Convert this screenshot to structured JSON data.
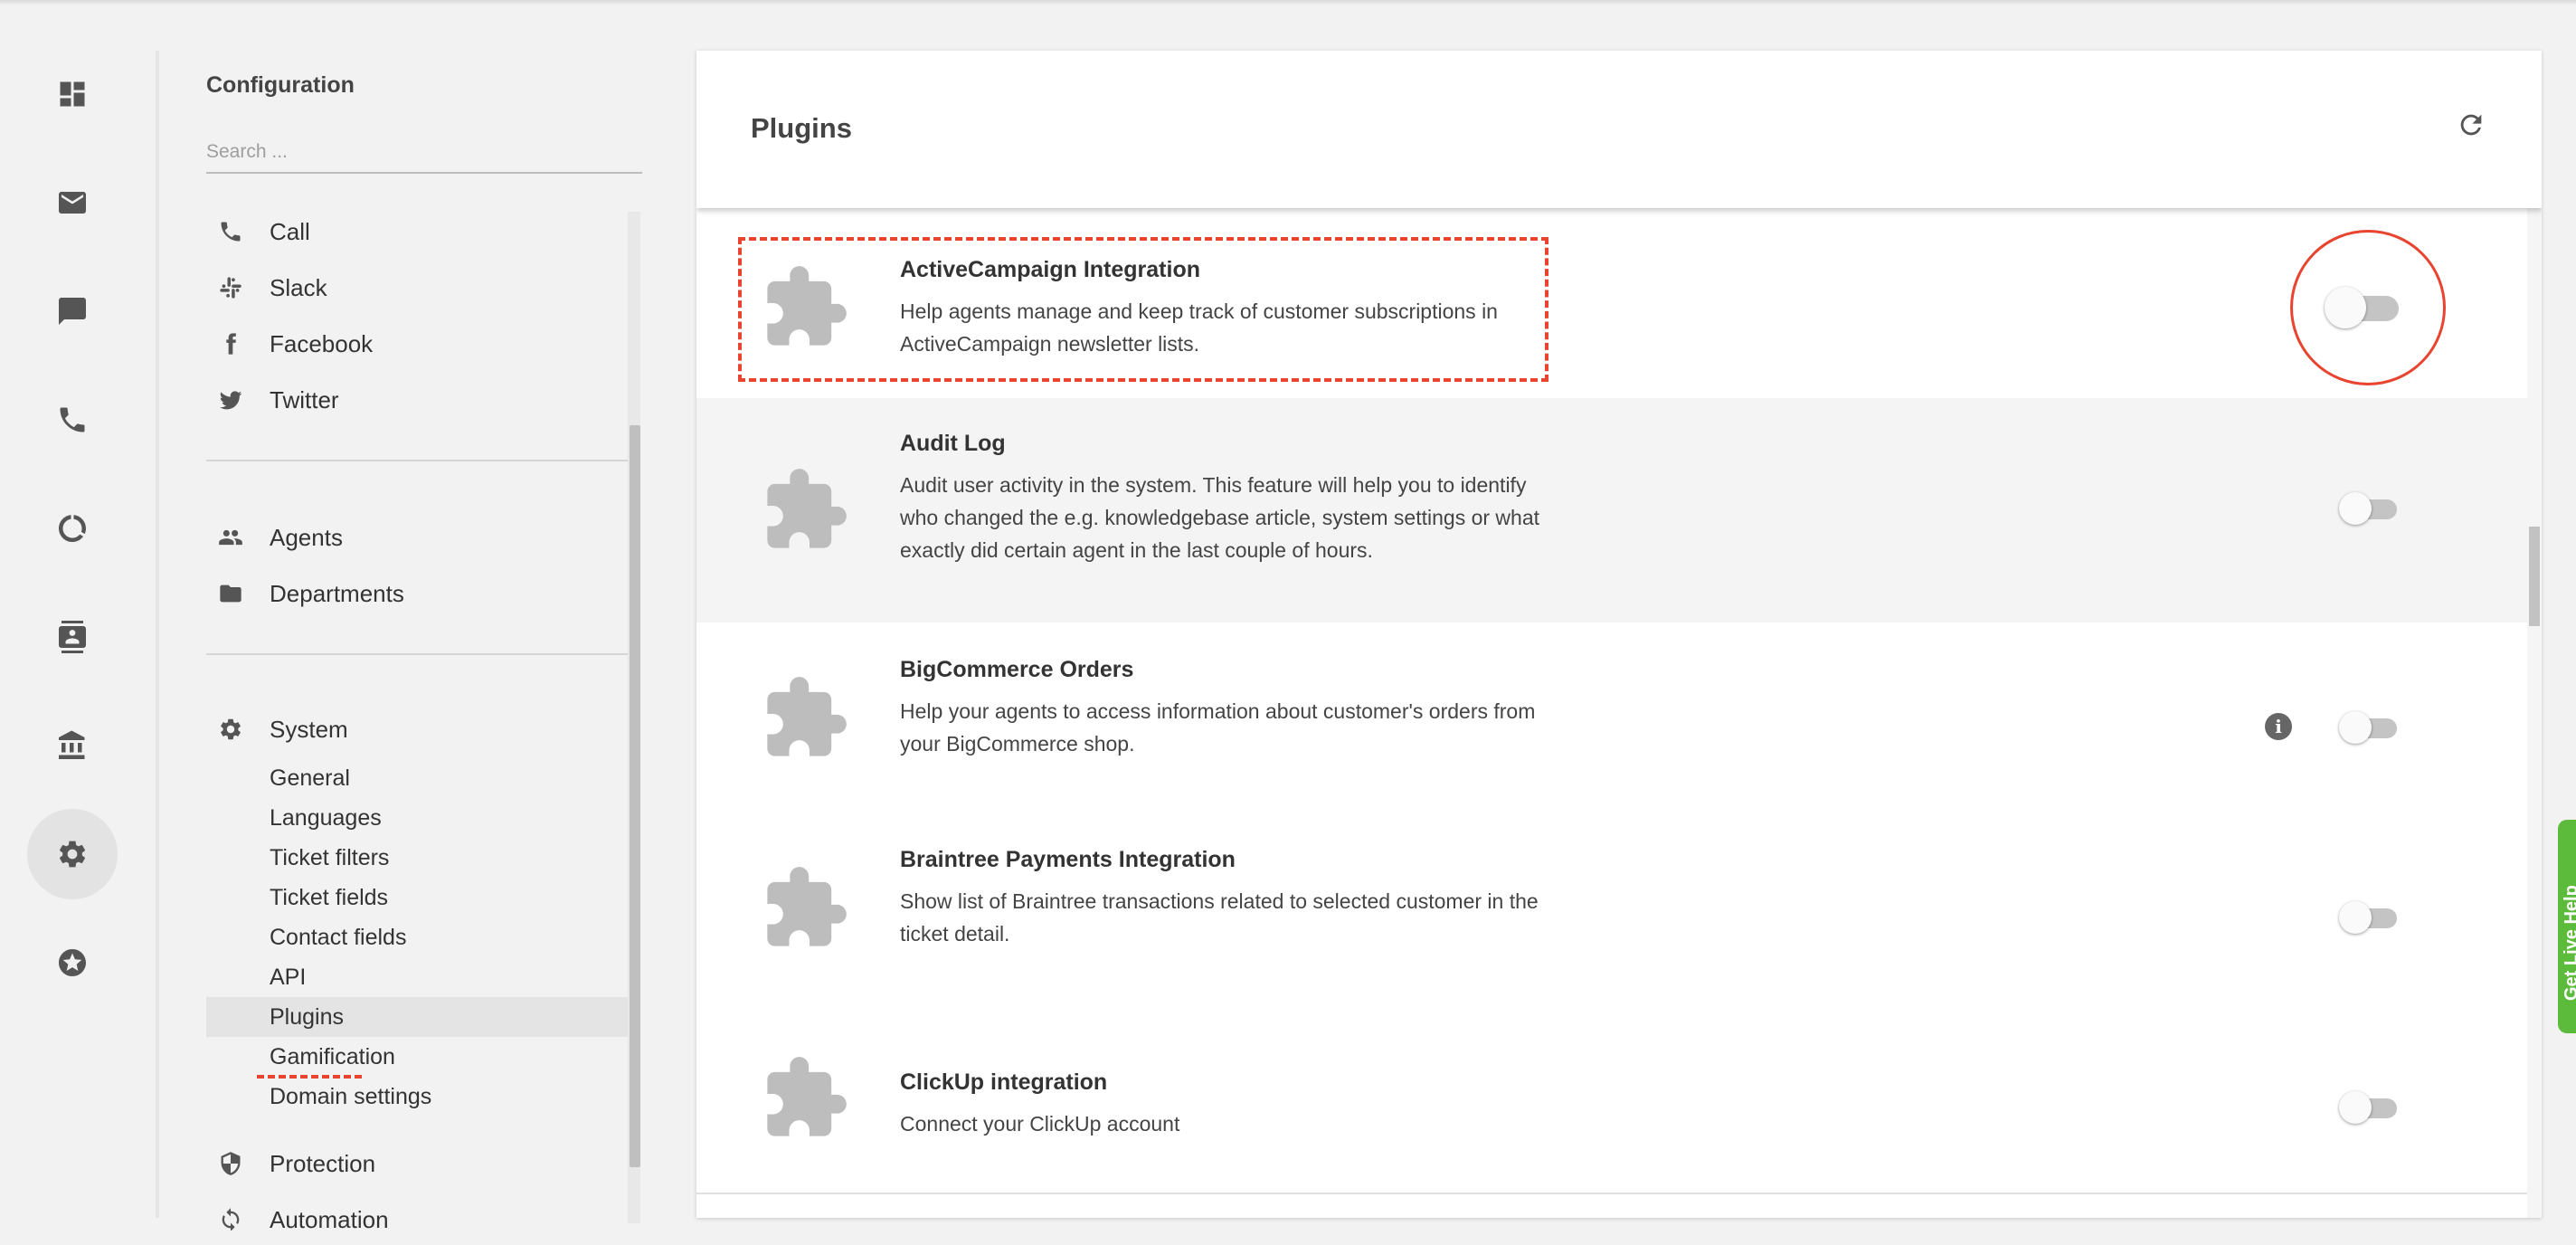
{
  "rail": {
    "items": [
      {
        "name": "dashboard-icon"
      },
      {
        "name": "mail-icon"
      },
      {
        "name": "chat-icon"
      },
      {
        "name": "phone-icon"
      },
      {
        "name": "reports-icon"
      },
      {
        "name": "contacts-icon"
      },
      {
        "name": "knowledgebase-icon"
      },
      {
        "name": "settings-icon",
        "active": true
      },
      {
        "name": "star-icon"
      }
    ]
  },
  "config": {
    "title": "Configuration",
    "search_placeholder": "Search ...",
    "channels": [
      "Call",
      "Slack",
      "Facebook",
      "Twitter"
    ],
    "people": [
      "Agents",
      "Departments"
    ],
    "system": {
      "label": "System",
      "items": [
        "General",
        "Languages",
        "Ticket filters",
        "Ticket fields",
        "Contact fields",
        "API",
        "Plugins",
        "Gamification",
        "Domain settings"
      ],
      "active": "Plugins"
    },
    "protection": "Protection",
    "automation": "Automation"
  },
  "panel": {
    "title": "Plugins",
    "plugins": [
      {
        "name": "ActiveCampaign Integration",
        "desc": "Help agents manage and keep track of customer subscriptions in ActiveCampaign newsletter lists.",
        "enabled": false
      },
      {
        "name": "Audit Log",
        "desc": "Audit user activity in the system. This feature will help you to identify who changed the e.g. knowledgebase article, system settings or what exactly did certain agent in the last couple of hours.",
        "enabled": false
      },
      {
        "name": "BigCommerce Orders",
        "desc": "Help your agents to access information about customer's orders from your BigCommerce shop.",
        "enabled": false,
        "info": "i"
      },
      {
        "name": "Braintree Payments Integration",
        "desc": "Show list of Braintree transactions related to selected customer in the ticket detail.",
        "enabled": false
      },
      {
        "name": "ClickUp integration",
        "desc": "Connect your ClickUp account",
        "enabled": false
      }
    ]
  },
  "live_help": {
    "label": "Get Live Help",
    "color": "#5dbb3b"
  },
  "annotation_color": "#e8442f"
}
